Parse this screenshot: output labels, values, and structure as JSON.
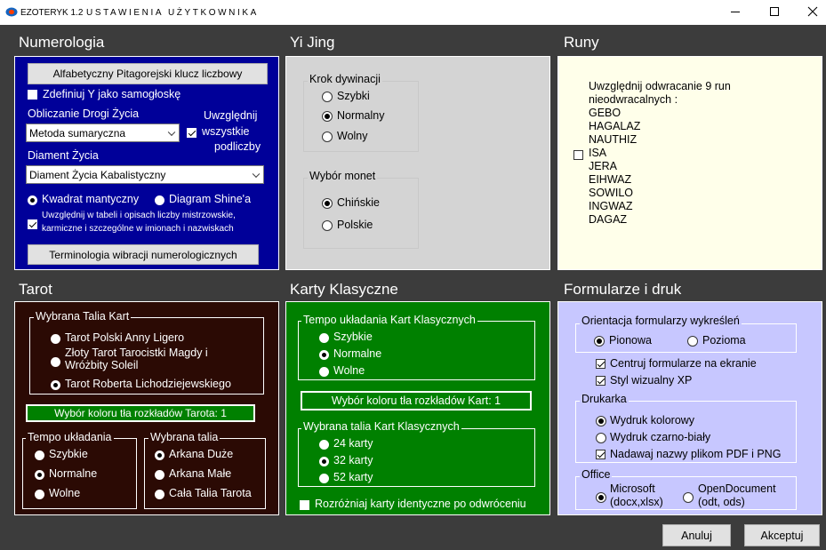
{
  "window": {
    "app_name": "EZOTERYK 1.2",
    "title": "USTAWIENIA UŻYTKOWNIKA"
  },
  "numerologia": {
    "header": "Numerologia",
    "alpha_button": "Alfabetyczny Pitagorejski klucz liczbowy",
    "define_y": "Zdefiniuj Y jako samogłoskę",
    "life_path_label": "Obliczanie Drogi Życia",
    "life_path_value": "Metoda sumaryczna",
    "include_all_1": "Uwzględnij",
    "include_all_2": "wszystkie",
    "include_all_3": "podliczby",
    "diamond_label": "Diament Życia",
    "diamond_value": "Diament Życia Kabalistyczny",
    "radio_square": "Kwadrat mantyczny",
    "radio_diagram": "Diagram Shine'a",
    "master_1": "Uwzględnij  w tabeli i opisach liczby mistrzowskie,",
    "master_2": "karmiczne i szczególne w imionach i nazwiskach",
    "term_button": "Terminologia wibracji numerologicznych"
  },
  "yijing": {
    "header": "Yi Jing",
    "step_label": "Krok dywinacji",
    "step_options": [
      "Szybki",
      "Normalny",
      "Wolny"
    ],
    "coins_label": "Wybór monet",
    "coins_options": [
      "Chińskie",
      "Polskie"
    ]
  },
  "runy": {
    "header": "Runy",
    "text_1": "Uwzględnij odwracanie 9 run",
    "text_2": "nieodwracalnych :",
    "runes": [
      "GEBO",
      "HAGALAZ",
      "NAUTHIZ",
      "ISA",
      "JERA",
      "EIHWAZ",
      "SOWILO",
      "INGWAZ",
      "DAGAZ"
    ]
  },
  "tarot": {
    "header": "Tarot",
    "deck_label": "Wybrana Talia Kart",
    "deck_1": "Tarot Polski Anny Ligero",
    "deck_2a": "Złoty Tarot Tarocistki Magdy i",
    "deck_2b": "Wróżbity Soleil",
    "deck_3": "Tarot Roberta Lichodziejewskiego",
    "color_button": "Wybór koloru tła rozkładów Tarota: 1",
    "tempo_label": "Tempo układania",
    "tempo_options": [
      "Szybkie",
      "Normalne",
      "Wolne"
    ],
    "talia_label": "Wybrana talia",
    "talia_options": [
      "Arkana Duże",
      "Arkana Małe",
      "Cała Talia Tarota"
    ]
  },
  "karty": {
    "header": "Karty Klasyczne",
    "tempo_label": "Tempo układania Kart Klasycznych",
    "tempo_options": [
      "Szybkie",
      "Normalne",
      "Wolne"
    ],
    "color_button": "Wybór koloru tła rozkładów Kart: 1",
    "talia_label": "Wybrana talia Kart Klasycznych",
    "talia_options": [
      "24 karty",
      "32 karty",
      "52 karty"
    ],
    "distinguish": "Rozróżniaj karty identyczne po odwróceniu"
  },
  "formularze": {
    "header": "Formularze i druk",
    "orient_label": "Orientacja formularzy wykreśleń",
    "orient_options": [
      "Pionowa",
      "Pozioma"
    ],
    "center": "Centruj formularze na ekranie",
    "xp": "Styl wizualny XP",
    "printer_label": "Drukarka",
    "printer_color": "Wydruk kolorowy",
    "printer_bw": "Wydruk czarno-biały",
    "names": "Nadawaj nazwy plikom PDF i PNG",
    "office_label": "Office",
    "office_ms_1": "Microsoft",
    "office_ms_2": "(docx,xlsx)",
    "office_od_1": "OpenDocument",
    "office_od_2": "(odt, ods)"
  },
  "footer": {
    "cancel": "Anuluj",
    "accept": "Akceptuj"
  },
  "colors": {
    "numerologia_bg": "#000099",
    "yijing_bg": "#d4d4d4",
    "runy_bg": "#ffffea",
    "tarot_bg": "#2b0a04",
    "karty_bg": "#008000",
    "formularze_bg": "#c7c7ff"
  }
}
